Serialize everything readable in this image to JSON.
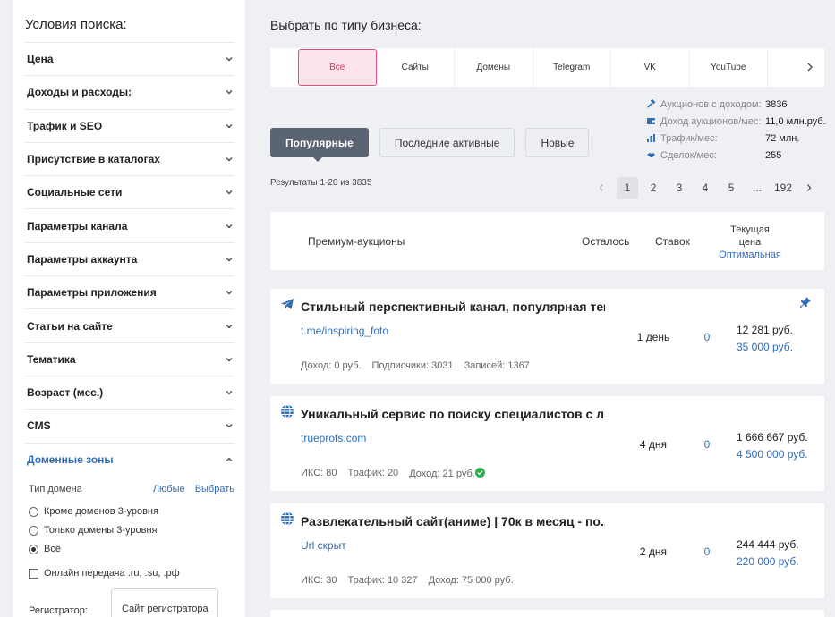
{
  "sidebar": {
    "title": "Условия поиска:",
    "items": [
      {
        "label": "Цена"
      },
      {
        "label": "Доходы и расходы:"
      },
      {
        "label": "Трафик и SEO"
      },
      {
        "label": "Присутствие в каталогах"
      },
      {
        "label": "Социальные сети"
      },
      {
        "label": "Параметры канала"
      },
      {
        "label": "Параметры аккаунта"
      },
      {
        "label": "Параметры приложения"
      },
      {
        "label": "Статьи на сайте"
      },
      {
        "label": "Тематика"
      },
      {
        "label": "Возраст (мес.)"
      },
      {
        "label": "CMS"
      },
      {
        "label": "Доменные зоны"
      }
    ],
    "domain": {
      "type_label": "Тип домена",
      "any_link": "Любые",
      "choose_link": "Выбрать",
      "radios": [
        "Кроме доменов 3-уровня",
        "Только домены 3-уровня",
        "Всё"
      ],
      "checkbox": "Онлайн передача .ru, .su, .рф",
      "registrar_label": "Регистратор:",
      "registrar_placeholder": "Сайт регистратора"
    }
  },
  "main": {
    "title": "Выбрать по типу бизнеса:",
    "biz_tabs": [
      "Все",
      "Сайты",
      "Домены",
      "Telegram",
      "VK",
      "YouTube"
    ],
    "stats": [
      {
        "label": "Аукционов с доходом:",
        "value": "3836"
      },
      {
        "label": "Доход аукционов/мес:",
        "value": "11,0 млн.руб."
      },
      {
        "label": "Трафик/мес:",
        "value": "72 млн."
      },
      {
        "label": "Сделок/мес:",
        "value": "255"
      }
    ],
    "sort_tabs": [
      "Популярные",
      "Последние активные",
      "Новые"
    ],
    "results": "Результаты 1-20 из 3835",
    "pager": [
      "1",
      "2",
      "3",
      "4",
      "5",
      "...",
      "192"
    ],
    "table_head": {
      "premium": "Премиум-аукционы",
      "remain": "Осталось",
      "bids": "Ставок",
      "price_line1": "Текущая",
      "price_line2": "цена",
      "price_opt": "Оптимальная"
    },
    "cards": [
      {
        "title": "Стильный перспективный канал, популярная тем...",
        "link": "t.me/inspiring_foto",
        "meta": [
          "Доход: 0 руб.",
          "Подписчики: 3031",
          "Записей: 1367"
        ],
        "remain": "1 день",
        "bids": "0",
        "price": "12 281 руб.",
        "buy_price": "35 000 руб."
      },
      {
        "title": "Уникальный сервис по поиску специалистов с ли...",
        "link": "trueprofs.com",
        "meta": [
          "ИКС: 80",
          "Трафик: 20",
          "Доход: 21 руб."
        ],
        "remain": "4 дня",
        "bids": "0",
        "price": "1 666 667 руб.",
        "buy_price": "4 500 000 руб."
      },
      {
        "title": "Развлекательный сайт(аниме) | 70к в месяц - по...",
        "link": "Url скрыт",
        "meta": [
          "ИКС: 30",
          "Трафик: 10 327",
          "Доход: 75 000 руб."
        ],
        "remain": "2 дня",
        "bids": "0",
        "price": "244 444 руб.",
        "buy_price": "220 000 руб."
      }
    ]
  }
}
